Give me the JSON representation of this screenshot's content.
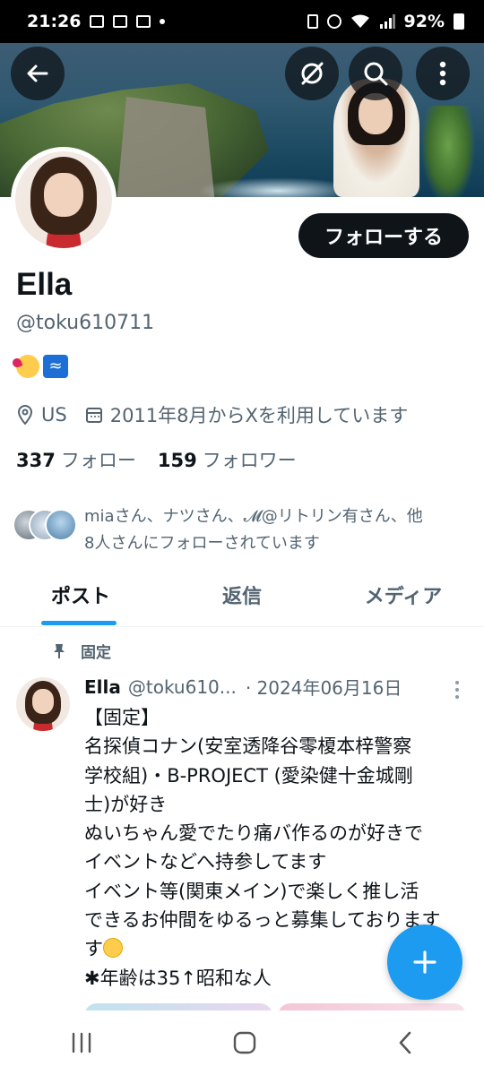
{
  "status_bar": {
    "time": "21:26",
    "battery": "92%"
  },
  "profile": {
    "name": "Ella",
    "handle": "@toku610711",
    "location": "US",
    "joined": "2011年8月からXを利用しています",
    "following_count": "337",
    "following_label": "フォロー",
    "followers_count": "159",
    "followers_label": "フォロワー",
    "follow_button": "フォローする"
  },
  "followed_by": {
    "line1": "miaさん、ナツさん、𝓜@リトリン有さん、他",
    "line2": "8人さんにフォローされています"
  },
  "tabs": [
    {
      "label": "ポスト",
      "active": true
    },
    {
      "label": "返信",
      "active": false
    },
    {
      "label": "メディア",
      "active": false
    }
  ],
  "pinned_label": "固定",
  "post": {
    "author": "Ella",
    "handle": "@toku610...",
    "date": "· 2024年06月16日",
    "lines": [
      "【固定】",
      "名探偵コナン(安室透降谷零榎本梓警察",
      "学校組)・B-PROJECT (愛染健十金城剛",
      "士)が好き",
      "ぬいちゃん愛でたり痛バ作るのが好きで",
      "イベントなどへ持参してます",
      "イベント等(関東メイン)で楽しく推し活",
      "できるお仲間をゆるっと募集しております",
      "す",
      "✱年齢は35↑昭和な人"
    ]
  },
  "colors": {
    "accent": "#1d9bf0",
    "text": "#0f1419",
    "muted": "#536471"
  }
}
